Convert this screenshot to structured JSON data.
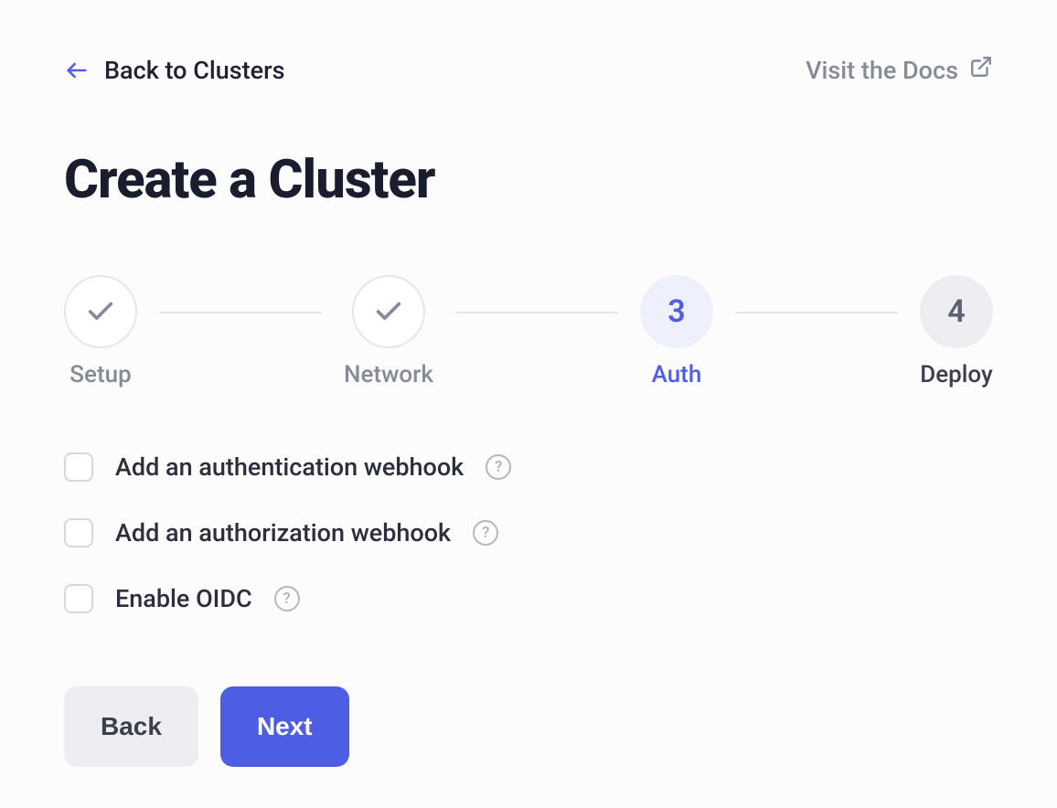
{
  "header": {
    "back_label": "Back to Clusters",
    "docs_label": "Visit the Docs"
  },
  "page_title": "Create a Cluster",
  "stepper": {
    "steps": [
      {
        "label": "Setup",
        "state": "completed"
      },
      {
        "label": "Network",
        "state": "completed"
      },
      {
        "label": "Auth",
        "num": "3",
        "state": "active"
      },
      {
        "label": "Deploy",
        "num": "4",
        "state": "pending"
      }
    ]
  },
  "options": [
    {
      "label": "Add an authentication webhook"
    },
    {
      "label": "Add an authorization webhook"
    },
    {
      "label": "Enable OIDC"
    }
  ],
  "buttons": {
    "back": "Back",
    "next": "Next"
  }
}
